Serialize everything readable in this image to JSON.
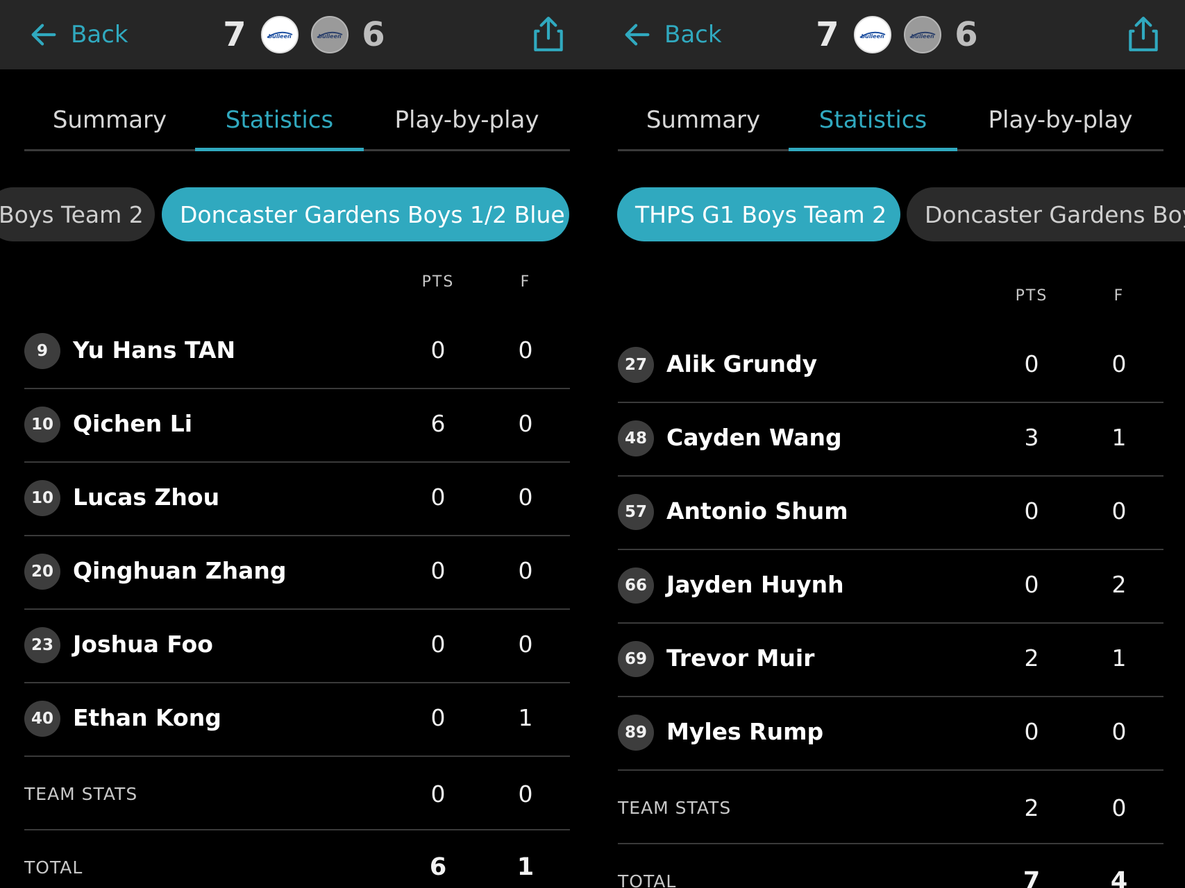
{
  "accent": "#30a9bf",
  "header": {
    "back_label": "Back",
    "home_score": "7",
    "away_score": "6",
    "home_logo_text": "bulleen",
    "away_logo_text": "bulleen"
  },
  "tabs": [
    "Summary",
    "Statistics",
    "Play-by-play"
  ],
  "left": {
    "team_chips": [
      "Boys Team 2",
      "Doncaster Gardens Boys 1/2 Blue"
    ],
    "columns": [
      "PTS",
      "F"
    ],
    "players": [
      {
        "number": "9",
        "name": "Yu Hans TAN",
        "pts": "0",
        "f": "0"
      },
      {
        "number": "10",
        "name": "Qichen Li",
        "pts": "6",
        "f": "0"
      },
      {
        "number": "10",
        "name": "Lucas Zhou",
        "pts": "0",
        "f": "0"
      },
      {
        "number": "20",
        "name": "Qinghuan Zhang",
        "pts": "0",
        "f": "0"
      },
      {
        "number": "23",
        "name": "Joshua Foo",
        "pts": "0",
        "f": "0"
      },
      {
        "number": "40",
        "name": "Ethan Kong",
        "pts": "0",
        "f": "1"
      }
    ],
    "team_stats": {
      "label": "TEAM STATS",
      "pts": "0",
      "f": "0"
    },
    "total": {
      "label": "TOTAL",
      "pts": "6",
      "f": "1"
    }
  },
  "right": {
    "team_chips": [
      "THPS G1 Boys Team 2",
      "Doncaster Gardens Boy"
    ],
    "columns": [
      "PTS",
      "F"
    ],
    "players": [
      {
        "number": "27",
        "name": "Alik Grundy",
        "pts": "0",
        "f": "0"
      },
      {
        "number": "48",
        "name": "Cayden Wang",
        "pts": "3",
        "f": "1"
      },
      {
        "number": "57",
        "name": "Antonio Shum",
        "pts": "0",
        "f": "0"
      },
      {
        "number": "66",
        "name": "Jayden Huynh",
        "pts": "0",
        "f": "2"
      },
      {
        "number": "69",
        "name": "Trevor Muir",
        "pts": "2",
        "f": "1"
      },
      {
        "number": "89",
        "name": "Myles Rump",
        "pts": "0",
        "f": "0"
      }
    ],
    "team_stats": {
      "label": "TEAM STATS",
      "pts": "2",
      "f": "0"
    },
    "total": {
      "label": "TOTAL",
      "pts": "7",
      "f": "4"
    }
  }
}
